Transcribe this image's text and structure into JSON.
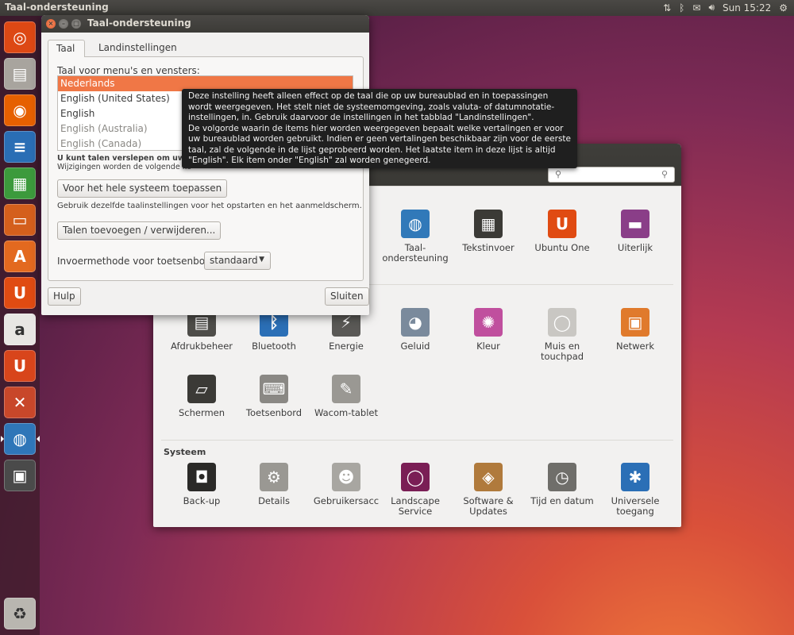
{
  "top_panel": {
    "title": "Taal-ondersteuning",
    "time": "Sun 15:22",
    "icons": [
      "network-arrows-icon",
      "bluetooth-icon",
      "mail-icon",
      "volume-icon",
      "power-icon"
    ]
  },
  "launcher": {
    "items": [
      {
        "name": "dash-home-icon",
        "glyph": "◎",
        "color": "#dd4814"
      },
      {
        "name": "files-icon",
        "glyph": "▤",
        "color": "#a8a49e"
      },
      {
        "name": "firefox-icon",
        "glyph": "◉",
        "color": "#e66000"
      },
      {
        "name": "writer-icon",
        "glyph": "≡",
        "color": "#2a6eb5"
      },
      {
        "name": "calc-icon",
        "glyph": "▦",
        "color": "#3c9a3c"
      },
      {
        "name": "impress-icon",
        "glyph": "▭",
        "color": "#d45f1c"
      },
      {
        "name": "software-center-icon",
        "glyph": "A",
        "color": "#e3691f"
      },
      {
        "name": "ubuntu-one-icon",
        "glyph": "U",
        "color": "#e04b12"
      },
      {
        "name": "amazon-icon",
        "glyph": "a",
        "color": "#e8e6e3"
      },
      {
        "name": "ubuntu-one-music-icon",
        "glyph": "U",
        "color": "#d8451b"
      },
      {
        "name": "system-settings-icon",
        "glyph": "✕",
        "color": "#c8472a"
      },
      {
        "name": "language-support-icon",
        "glyph": "◍",
        "color": "#2f76b8"
      },
      {
        "name": "backup-icon",
        "glyph": "▣",
        "color": "#4a4a4a"
      }
    ],
    "trash": {
      "name": "trash-icon",
      "glyph": "♻",
      "color": "#b9b6b0"
    }
  },
  "settings": {
    "search_placeholder": "",
    "personal_items": [
      {
        "name": "taal-ondersteuning",
        "label": "Taal-\nondersteuning",
        "glyph": "◍",
        "color": "#3179b9"
      },
      {
        "name": "tekstinvoer",
        "label": "Tekstinvoer",
        "glyph": "▦",
        "color": "#3b3a36"
      },
      {
        "name": "ubuntu-one",
        "label": "Ubuntu One",
        "glyph": "U",
        "color": "#e04b12"
      },
      {
        "name": "uiterlijk",
        "label": "Uiterlijk",
        "glyph": "▬",
        "color": "#8a3e88"
      }
    ],
    "hardware_items_row1": [
      {
        "name": "afdrukbeheer",
        "label": "Afdrukbeheer",
        "glyph": "▤",
        "color": "#4e4d49"
      },
      {
        "name": "bluetooth",
        "label": "Bluetooth",
        "glyph": "ᛒ",
        "color": "#2b6fb6"
      },
      {
        "name": "energie",
        "label": "Energie",
        "glyph": "⚡",
        "color": "#5a5956"
      },
      {
        "name": "geluid",
        "label": "Geluid",
        "glyph": "◕",
        "color": "#7a8a9c"
      },
      {
        "name": "kleur",
        "label": "Kleur",
        "glyph": "✺",
        "color": "#c04f9e"
      },
      {
        "name": "muis",
        "label": "Muis en\ntouchpad",
        "glyph": "◯",
        "color": "#c9c7c3"
      },
      {
        "name": "netwerk",
        "label": "Netwerk",
        "glyph": "▣",
        "color": "#e07a2c"
      }
    ],
    "hardware_items_row2": [
      {
        "name": "schermen",
        "label": "Schermen",
        "glyph": "▱",
        "color": "#3b3a36"
      },
      {
        "name": "toetsenbord",
        "label": "Toetsenbord",
        "glyph": "⌨",
        "color": "#8a8884"
      },
      {
        "name": "wacom",
        "label": "Wacom-tablet",
        "glyph": "✎",
        "color": "#9a9893"
      }
    ],
    "system_title": "Systeem",
    "system_items": [
      {
        "name": "back-up",
        "label": "Back-up",
        "glyph": "◘",
        "color": "#2b2a28"
      },
      {
        "name": "details",
        "label": "Details",
        "glyph": "⚙",
        "color": "#9a9893"
      },
      {
        "name": "gebruikers",
        "label": "Gebruikersacc",
        "glyph": "☻",
        "color": "#a8a6a1"
      },
      {
        "name": "landscape",
        "label": "Landscape\nService",
        "glyph": "◯",
        "color": "#7a1e55"
      },
      {
        "name": "software-updates",
        "label": "Software &\nUpdates",
        "glyph": "◈",
        "color": "#b07a3c"
      },
      {
        "name": "tijd",
        "label": "Tijd en datum",
        "glyph": "◷",
        "color": "#6f6e6a"
      },
      {
        "name": "universele",
        "label": "Universele\ntoegang",
        "glyph": "✱",
        "color": "#2b6fb6"
      }
    ]
  },
  "lang_window": {
    "title": "Taal-ondersteuning",
    "tabs": [
      "Taal",
      "Landinstellingen"
    ],
    "list_label": "Taal voor menu's en vensters:",
    "languages": [
      {
        "label": "Nederlands",
        "state": "selected"
      },
      {
        "label": "English (United States)",
        "state": "normal"
      },
      {
        "label": "English",
        "state": "normal"
      },
      {
        "label": "English (Australia)",
        "state": "dim"
      },
      {
        "label": "English (Canada)",
        "state": "dim"
      }
    ],
    "hint_bold": "U kunt talen verslepen om uw voor",
    "hint_regular": "Wijzigingen worden de volgende kee",
    "apply_button": "Voor het hele systeem toepassen",
    "login_hint": "Gebruik dezelfde taalinstellingen voor het opstarten en het aanmeldscherm.",
    "addremove_button": "Talen toevoegen / verwijderen...",
    "input_label": "Invoermethode voor toetsenbord:",
    "input_value": "standaard",
    "help_button": "Hulp",
    "close_button": "Sluiten"
  },
  "tooltip": {
    "line1": "Deze instelling heeft alleen effect op de taal die op uw bureaublad en in toepassingen wordt weergegeven. Het stelt niet de systeemomgeving, zoals valuta- of datumnotatie-instellingen, in. Gebruik daarvoor de instellingen in het tabblad \"Landinstellingen\".",
    "line2": "De volgorde waarin de items hier worden weergegeven bepaalt welke vertalingen er voor uw bureaublad worden gebruikt. Indien er geen vertalingen beschikbaar zijn voor de eerste taal, zal de volgende in de lijst geprobeerd worden. Het laatste item in deze lijst is altijd \"English\". Elk item onder \"English\" zal worden genegeerd."
  }
}
